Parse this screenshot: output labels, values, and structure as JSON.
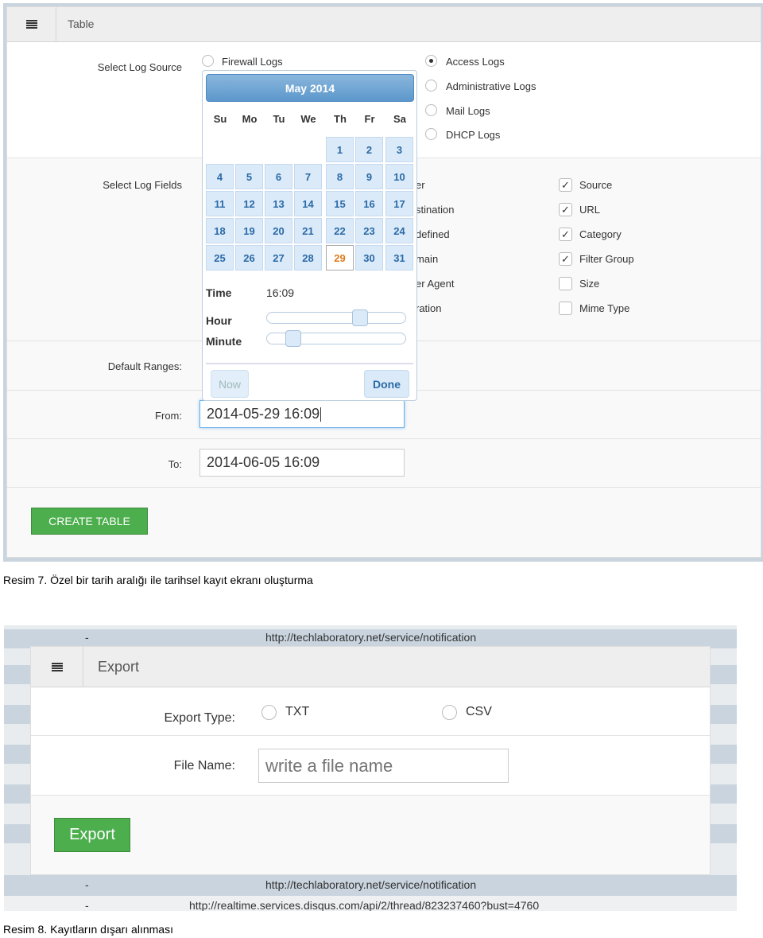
{
  "figure1": {
    "header": {
      "title": "Table"
    },
    "log_source": {
      "label": "Select Log Source",
      "options": [
        {
          "label": "Firewall Logs",
          "selected": false
        },
        {
          "label": "Access Logs",
          "selected": true
        },
        {
          "label": "Administrative Logs",
          "selected": false
        },
        {
          "label": "Mail Logs",
          "selected": false
        },
        {
          "label": "DHCP Logs",
          "selected": false
        }
      ]
    },
    "log_fields": {
      "label": "Select Log Fields",
      "left_partial": [
        "er",
        "stination",
        "defined",
        "main",
        "er Agent",
        "ration"
      ],
      "right": [
        {
          "label": "Source",
          "checked": true
        },
        {
          "label": "URL",
          "checked": true
        },
        {
          "label": "Category",
          "checked": true
        },
        {
          "label": "Filter Group",
          "checked": true
        },
        {
          "label": "Size",
          "checked": false
        },
        {
          "label": "Mime Type",
          "checked": false
        }
      ]
    },
    "default_ranges": {
      "label": "Default Ranges:"
    },
    "from": {
      "label": "From:",
      "value": "2014-05-29 16:09"
    },
    "to": {
      "label": "To:",
      "value": "2014-06-05 16:09"
    },
    "create_button": "CREATE TABLE",
    "calendar": {
      "month": "May 2014",
      "weekdays": [
        "Su",
        "Mo",
        "Tu",
        "We",
        "Th",
        "Fr",
        "Sa"
      ],
      "first_weekday": 4,
      "days": 31,
      "selected_day": 29,
      "time_label": "Time",
      "time_value": "16:09",
      "hour_label": "Hour",
      "minute_label": "Minute",
      "hour": 16,
      "minute": 9,
      "now_label": "Now",
      "done_label": "Done"
    },
    "caption": "Resim 7. Özel bir tarih aralığı ile tarihsel kayıt ekranı oluşturma"
  },
  "figure2": {
    "bg_rows": [
      {
        "dash": "-",
        "url": "http://techlaboratory.net/service/notification"
      },
      {
        "dash": "-",
        "url": "http://techlaboratory.net/service/notification"
      },
      {
        "dash": "-",
        "url": "http://realtime.services.disqus.com/api/2/thread/823237460?bust=4760"
      }
    ],
    "header": {
      "title": "Export"
    },
    "export_type": {
      "label": "Export Type:",
      "options": [
        {
          "label": "TXT",
          "selected": false
        },
        {
          "label": "CSV",
          "selected": false
        }
      ]
    },
    "file_name": {
      "label": "File Name:",
      "placeholder": "write a file name"
    },
    "export_button": "Export",
    "caption": "Resim 8. Kayıtların dışarı alınması"
  },
  "colors": {
    "accent_green": "#4cae4c",
    "calendar_blue": "#5c98cc",
    "today_orange": "#e07a1c"
  }
}
